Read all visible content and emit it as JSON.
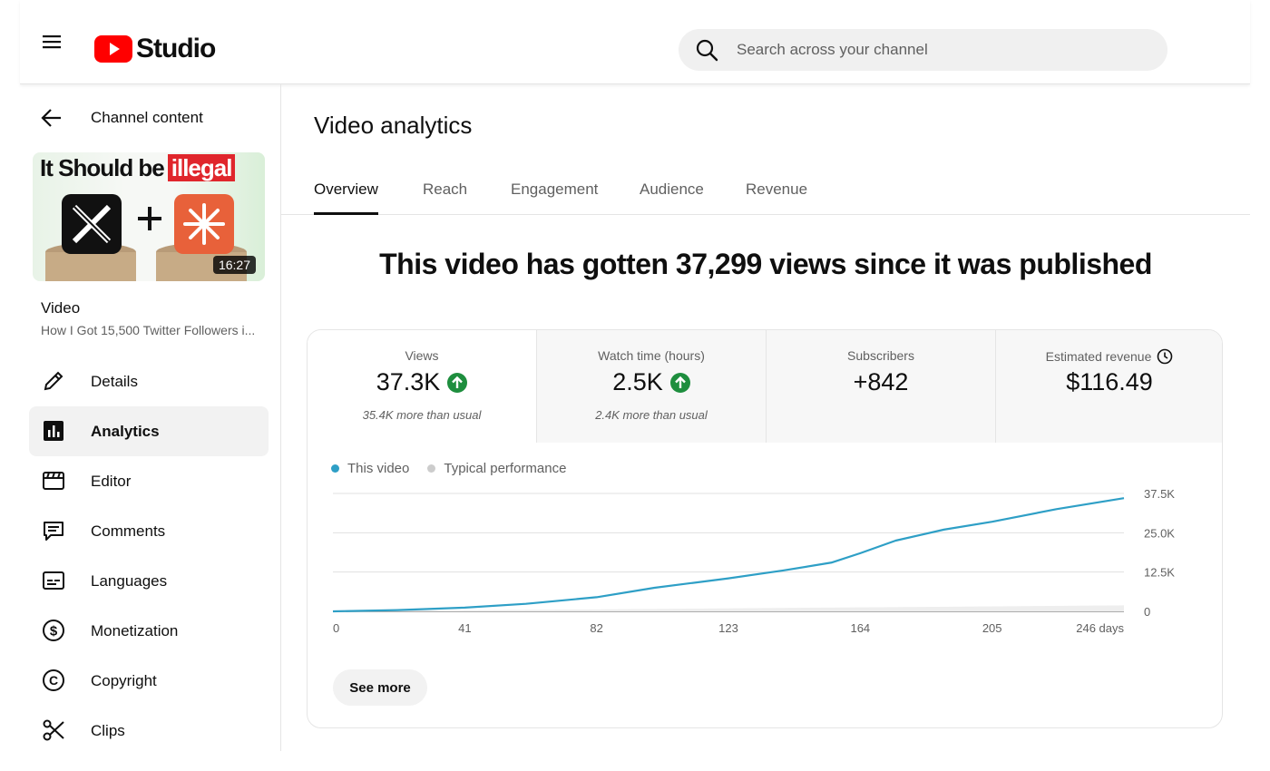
{
  "header": {
    "logo_text": "Studio",
    "search_placeholder": "Search across your channel"
  },
  "sidebar": {
    "back_label": "Channel content",
    "thumbnail": {
      "title_plain": "It Should be",
      "title_highlight": "illegal",
      "duration": "16:27"
    },
    "video_label": "Video",
    "video_name": "How I Got 15,500 Twitter Followers i...",
    "items": [
      {
        "label": "Details",
        "icon": "pencil-icon"
      },
      {
        "label": "Analytics",
        "icon": "analytics-icon",
        "active": true
      },
      {
        "label": "Editor",
        "icon": "editor-icon"
      },
      {
        "label": "Comments",
        "icon": "comments-icon"
      },
      {
        "label": "Languages",
        "icon": "subtitles-icon"
      },
      {
        "label": "Monetization",
        "icon": "dollar-icon"
      },
      {
        "label": "Copyright",
        "icon": "copyright-icon"
      },
      {
        "label": "Clips",
        "icon": "scissors-icon"
      }
    ]
  },
  "main": {
    "title": "Video analytics",
    "tabs": [
      "Overview",
      "Reach",
      "Engagement",
      "Audience",
      "Revenue"
    ],
    "active_tab": "Overview",
    "headline": "This video has gotten 37,299 views since it was published",
    "metrics": [
      {
        "label": "Views",
        "value": "37.3K",
        "sub": "35.4K more than usual",
        "trend": "up"
      },
      {
        "label": "Watch time (hours)",
        "value": "2.5K",
        "sub": "2.4K more than usual",
        "trend": "up"
      },
      {
        "label": "Subscribers",
        "value": "+842",
        "sub": ""
      },
      {
        "label": "Estimated revenue",
        "value": "$116.49",
        "sub": ""
      }
    ],
    "see_more": "See more"
  },
  "colors": {
    "accent_line": "#2e9fc6",
    "typical": "#cccccc",
    "up_green": "#1e8e3e",
    "brand_red": "#ff0000"
  },
  "chart_data": {
    "type": "line",
    "series": [
      {
        "name": "This video",
        "x": [
          0,
          20,
          41,
          60,
          82,
          100,
          123,
          140,
          155,
          164,
          175,
          190,
          205,
          225,
          246
        ],
        "y": [
          0,
          400,
          1200,
          2400,
          4500,
          7500,
          10500,
          13000,
          15500,
          18500,
          22500,
          26000,
          28500,
          32500,
          36000
        ]
      },
      {
        "name": "Typical performance",
        "x": [
          0,
          246
        ],
        "y": [
          0,
          1900
        ]
      }
    ],
    "x_ticks": [
      "0",
      "41",
      "82",
      "123",
      "164",
      "205",
      "246 days"
    ],
    "x_tick_values": [
      0,
      41,
      82,
      123,
      164,
      205,
      246
    ],
    "y_ticks": [
      "37.5K",
      "25.0K",
      "12.5K",
      "0"
    ],
    "y_tick_values": [
      37500,
      25000,
      12500,
      0
    ],
    "xlim": [
      0,
      246
    ],
    "ylim": [
      0,
      37500
    ],
    "grid": true,
    "legend": "top-left"
  }
}
